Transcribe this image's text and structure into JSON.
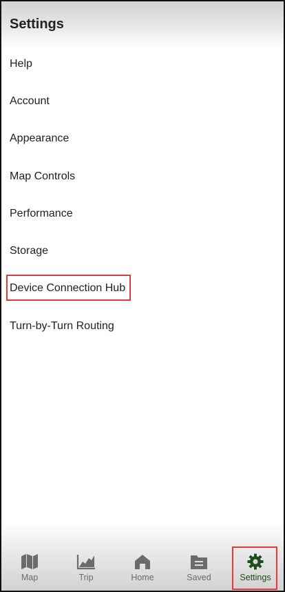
{
  "header": {
    "title": "Settings"
  },
  "menu": {
    "items": [
      {
        "label": "Help"
      },
      {
        "label": "Account"
      },
      {
        "label": "Appearance"
      },
      {
        "label": "Map Controls"
      },
      {
        "label": "Performance"
      },
      {
        "label": "Storage"
      },
      {
        "label": "Device Connection Hub"
      },
      {
        "label": "Turn-by-Turn Routing"
      }
    ]
  },
  "bottom_nav": {
    "items": [
      {
        "label": "Map",
        "icon": "map-icon"
      },
      {
        "label": "Trip",
        "icon": "chart-icon"
      },
      {
        "label": "Home",
        "icon": "home-icon"
      },
      {
        "label": "Saved",
        "icon": "folder-icon"
      },
      {
        "label": "Settings",
        "icon": "gear-icon",
        "active": true
      }
    ]
  },
  "colors": {
    "active_tab": "#1e4d20",
    "inactive_tab": "#6b6b6b",
    "highlight": "#e53935"
  }
}
